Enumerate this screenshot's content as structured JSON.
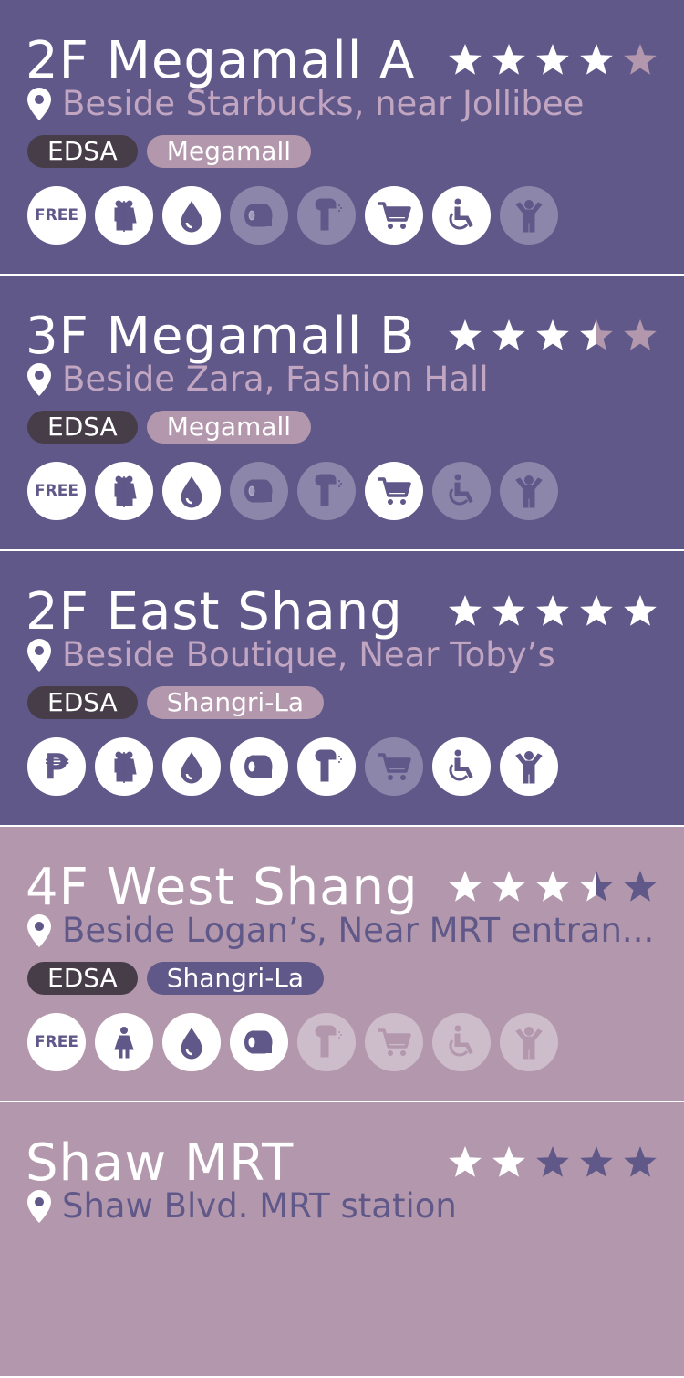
{
  "colors": {
    "dark_card": "#5f5889",
    "light_card": "#b398ad",
    "line_tag": "#463d48",
    "star_on": "#ffffff",
    "star_off_dark": "#b398ad",
    "star_off_light": "#5f5889"
  },
  "restrooms": [
    {
      "title": "2F Megamall A",
      "location": "Beside Starbucks, near Jollibee",
      "line": "EDSA",
      "place": "Megamall",
      "rating": 4,
      "theme": "dark",
      "fee": "FREE",
      "amenities": {
        "gender": "unisex",
        "bidet": true,
        "tissue": false,
        "dryer": false,
        "shopping": true,
        "pwd": true,
        "kids": false
      }
    },
    {
      "title": "3F Megamall B",
      "location": "Beside Zara, Fashion Hall",
      "line": "EDSA",
      "place": "Megamall",
      "rating": 3.5,
      "theme": "dark",
      "fee": "FREE",
      "amenities": {
        "gender": "unisex",
        "bidet": true,
        "tissue": false,
        "dryer": false,
        "shopping": true,
        "pwd": false,
        "kids": false
      }
    },
    {
      "title": "2F East Shang",
      "location": "Beside Boutique, Near Toby’s",
      "line": "EDSA",
      "place": "Shangri-La",
      "rating": 5,
      "theme": "dark",
      "fee": "₱",
      "amenities": {
        "gender": "unisex",
        "bidet": true,
        "tissue": true,
        "dryer": true,
        "shopping": false,
        "pwd": true,
        "kids": true
      }
    },
    {
      "title": "4F West Shang",
      "location": "Beside Logan’s, Near MRT entran...",
      "line": "EDSA",
      "place": "Shangri-La",
      "rating": 3.5,
      "theme": "light",
      "fee": "FREE",
      "amenities": {
        "gender": "female",
        "bidet": true,
        "tissue": true,
        "dryer": false,
        "shopping": false,
        "pwd": false,
        "kids": false
      }
    },
    {
      "title": "Shaw MRT",
      "location": "Shaw Blvd. MRT station",
      "line": "",
      "place": "",
      "rating": 2,
      "theme": "light",
      "fee": "",
      "amenities": null
    }
  ]
}
